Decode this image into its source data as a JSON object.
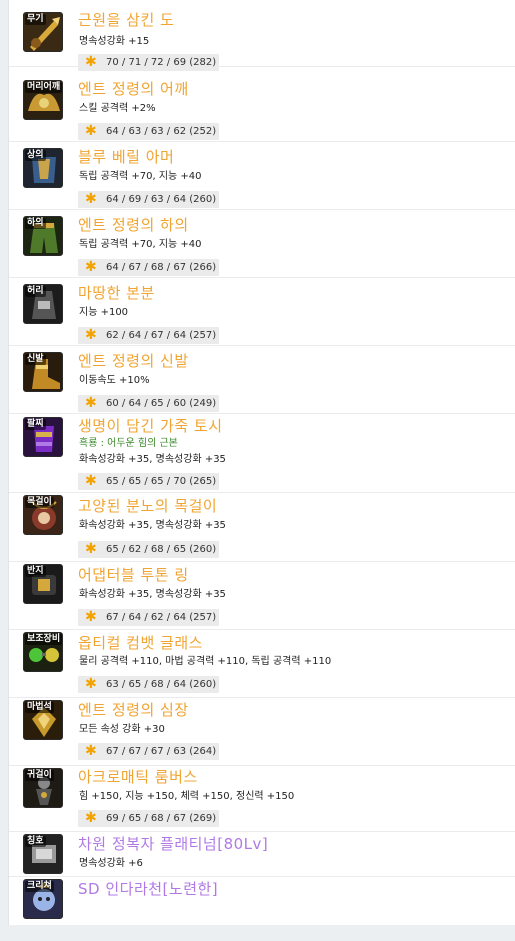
{
  "colors": {
    "normal": "#f0a532",
    "unique": "#b07ae6",
    "set": "#3a8a2a",
    "star": "#f2a300"
  },
  "items": [
    {
      "slot": "무기",
      "icon": "weapon-icon",
      "name": "근원을 삼킨 도",
      "lines": [
        "명속성강화 +15"
      ],
      "stats": "70 / 71 / 72 / 69 (282)"
    },
    {
      "slot": "머리어깨",
      "icon": "shoulder-icon",
      "name": "엔트 정령의 어깨",
      "lines": [
        "스킬 공격력 +2%"
      ],
      "stats": "64 / 63 / 63 / 62 (252)"
    },
    {
      "slot": "상의",
      "icon": "top-armor-icon",
      "name": "블루 베릴 아머",
      "lines": [
        "독립 공격력 +70, 지능 +40"
      ],
      "stats": "64 / 69 / 63 / 64 (260)"
    },
    {
      "slot": "하의",
      "icon": "bottom-armor-icon",
      "name": "엔트 정령의 하의",
      "lines": [
        "독립 공격력 +70, 지능 +40"
      ],
      "stats": "64 / 67 / 68 / 67 (266)"
    },
    {
      "slot": "허리",
      "icon": "belt-icon",
      "name": "마땅한 본분",
      "lines": [
        "지능 +100"
      ],
      "stats": "62 / 64 / 67 / 64 (257)"
    },
    {
      "slot": "신발",
      "icon": "boots-icon",
      "name": "엔트 정령의 신발",
      "lines": [
        "이동속도 +10%"
      ],
      "stats": "60 / 64 / 65 / 60 (249)"
    },
    {
      "slot": "팔찌",
      "icon": "bracelet-icon",
      "name": "생명이 담긴 가죽 토시",
      "set": "흑룡 : 어두운 힘의 근본",
      "lines": [
        "화속성강화 +35, 명속성강화 +35"
      ],
      "stats": "65 / 65 / 65 / 70 (265)"
    },
    {
      "slot": "목걸이",
      "icon": "necklace-icon",
      "name": "고양된 분노의 목걸이",
      "lines": [
        "화속성강화 +35, 명속성강화 +35"
      ],
      "stats": "65 / 62 / 68 / 65 (260)"
    },
    {
      "slot": "반지",
      "icon": "ring-icon",
      "name": "어댑터블 투톤 링",
      "lines": [
        "화속성강화 +35, 명속성강화 +35"
      ],
      "stats": "67 / 64 / 62 / 64 (257)"
    },
    {
      "slot": "보조장비",
      "icon": "glasses-icon",
      "name": "옵티컬 컴뱃 글래스",
      "lines": [
        "물리 공격력 +110, 마법 공격력 +110, 독립 공격력 +110"
      ],
      "stats": "63 / 65 / 68 / 64 (260)"
    },
    {
      "slot": "마법석",
      "icon": "magic-stone-icon",
      "name": "엔트 정령의 심장",
      "lines": [
        "모든 속성 강화 +30"
      ],
      "stats": "67 / 67 / 67 / 63 (264)"
    },
    {
      "slot": "귀걸이",
      "icon": "earring-icon",
      "name": "아크로매틱 룸버스",
      "lines": [
        "힘 +150, 지능 +150, 체력 +150, 정신력 +150"
      ],
      "stats": "69 / 65 / 68 / 67 (269)"
    },
    {
      "slot": "칭호",
      "icon": "title-badge-icon",
      "name": "차원 정복자 플래티넘[80Lv]",
      "rarity": "unique",
      "lines": [
        "명속성강화 +6"
      ]
    },
    {
      "slot": "크리쳐",
      "icon": "creature-icon",
      "name": "SD 인다라천[노련한]",
      "rarity": "unique",
      "lines": []
    }
  ]
}
